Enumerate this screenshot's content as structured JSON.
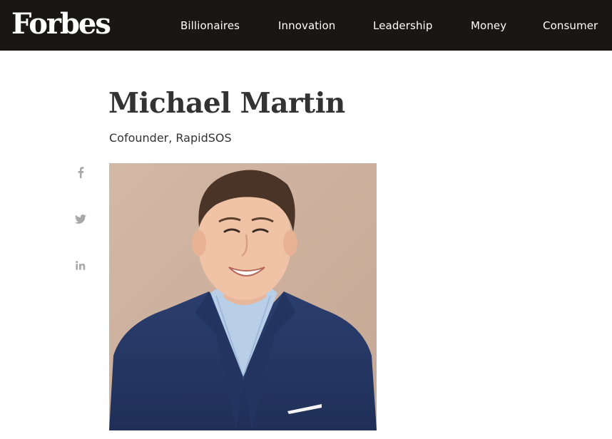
{
  "header": {
    "logo": "Forbes",
    "nav": [
      {
        "label": "Billionaires"
      },
      {
        "label": "Innovation"
      },
      {
        "label": "Leadership"
      },
      {
        "label": "Money"
      },
      {
        "label": "Consumer"
      }
    ],
    "background_color": "#181716",
    "text_color": "#ffffff"
  },
  "profile": {
    "name": "Michael Martin",
    "title": "Cofounder, RapidSOS"
  },
  "share": [
    {
      "icon": "facebook-icon"
    },
    {
      "icon": "twitter-icon"
    },
    {
      "icon": "linkedin-icon"
    }
  ],
  "icon_color": "#a8a8a8"
}
